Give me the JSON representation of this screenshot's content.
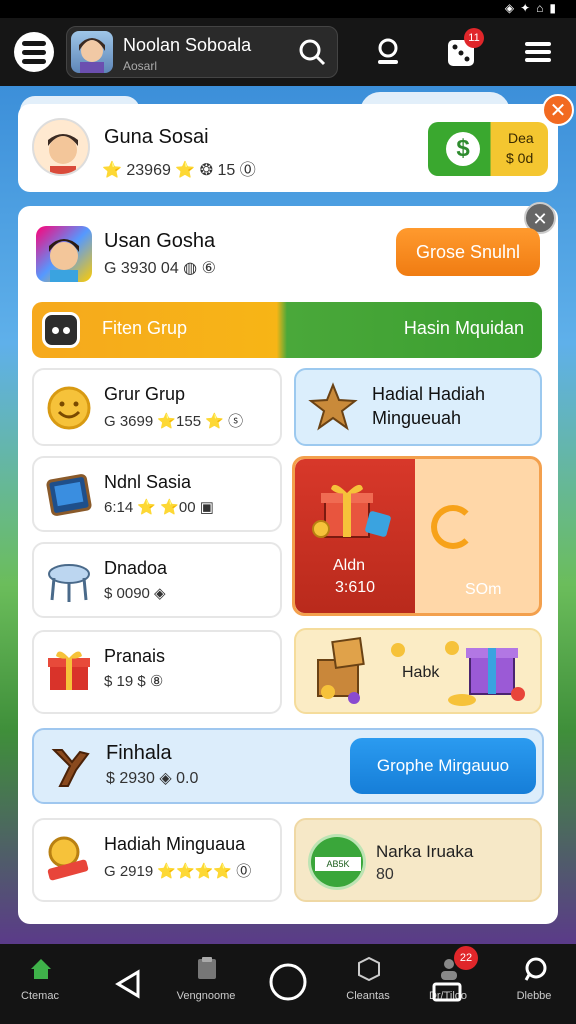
{
  "appbar": {
    "profile_name": "Noolan Soboala",
    "profile_sub": "Aosarl"
  },
  "notifications": {
    "dice_badge": "11",
    "nav_badge": "22"
  },
  "top_card": {
    "title": "Guna Sosai",
    "stats": "⭐ 23969 ⭐ ❂ 15 ⓪",
    "green_line1": "Dea",
    "green_line2": "$ 0d"
  },
  "user_row": {
    "name": "Usan Gosha",
    "stats": "G 3930 04 ◍ ⑥",
    "button": "Grose Snulnl"
  },
  "banner": {
    "left": "Fiten Grup",
    "right": "Hasin Mquidan"
  },
  "tiles": [
    {
      "title": "Grur Grup",
      "stats": "G 3699 ⭐155 ⭐ ⓢ"
    },
    {
      "title": "Ndnl Sasia",
      "stats": "6:14 ⭐ ⭐00 ▣"
    },
    {
      "title": "Dnadoa",
      "stats": "$ 0090 ◈"
    },
    {
      "title": "Pranais",
      "stats": "$ 19 $ ⑧"
    }
  ],
  "hadial_tile": {
    "line1": "Hadial Hadiah",
    "line2": "Mingueuah"
  },
  "gift_big": {
    "left1": "Aldn",
    "left2": "3:610",
    "right": "SOm"
  },
  "hadiah_tile": {
    "label": "Habk"
  },
  "long_tile": {
    "title": "Finhala",
    "stats": "$ 2930 ◈ 0.0",
    "button": "Grophe Mirgauuo"
  },
  "last_left": {
    "title": "Hadiah Minguaua",
    "stats": "G 2919 ⭐⭐⭐⭐ ⓪"
  },
  "last_right": {
    "badge": "AB5K",
    "title": "Narka Iruaka",
    "stats": "80"
  },
  "bottom_nav": [
    {
      "label": "Ctemac"
    },
    {
      "label": "Vengnoome"
    },
    {
      "label": "Cleantas"
    },
    {
      "label": "Dr/Tiloo"
    },
    {
      "label": "Dlebbe"
    }
  ],
  "colors": {
    "accent_orange": "#f07c12",
    "accent_green": "#3aa82f",
    "accent_blue": "#167ed8"
  }
}
